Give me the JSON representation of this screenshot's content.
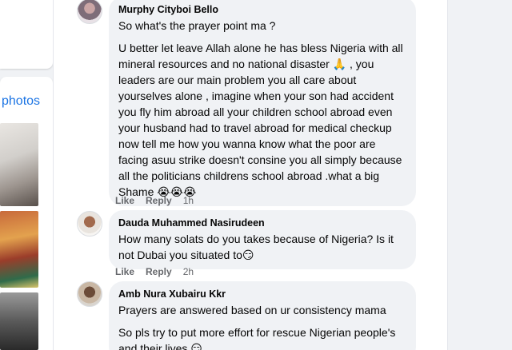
{
  "photos_section": {
    "title": "photos"
  },
  "comments": [
    {
      "author": "Murphy Cityboi Bello",
      "paragraphs": [
        "So what's the prayer point ma ?",
        "U better let leave Allah alone he has bless Nigeria with all mineral resources and no national disaster 🙏 , you leaders are our main problem you all care about yourselves alone , imagine when your son had accident you fly him abroad all your children school abroad even your husband had to travel abroad for medical checkup now tell me how you wanna know what the poor are facing asuu strike doesn't consine you all simply because all the politicians childrens school abroad .what a big Shame 😭😭😭"
      ],
      "like": "Like",
      "reply": "Reply",
      "time": "1h"
    },
    {
      "author": "Dauda Muhammed Nasirudeen",
      "paragraphs": [
        "How many solats do you takes because of Nigeria? Is it not Dubai you situated to😏"
      ],
      "like": "Like",
      "reply": "Reply",
      "time": "2h"
    },
    {
      "author": "Amb Nura Xubairu Kkr",
      "paragraphs": [
        "Prayers are answered based on ur consistency mama",
        "So pls try to put more effort for rescue Nigerian people's and their lives 😏"
      ]
    }
  ]
}
